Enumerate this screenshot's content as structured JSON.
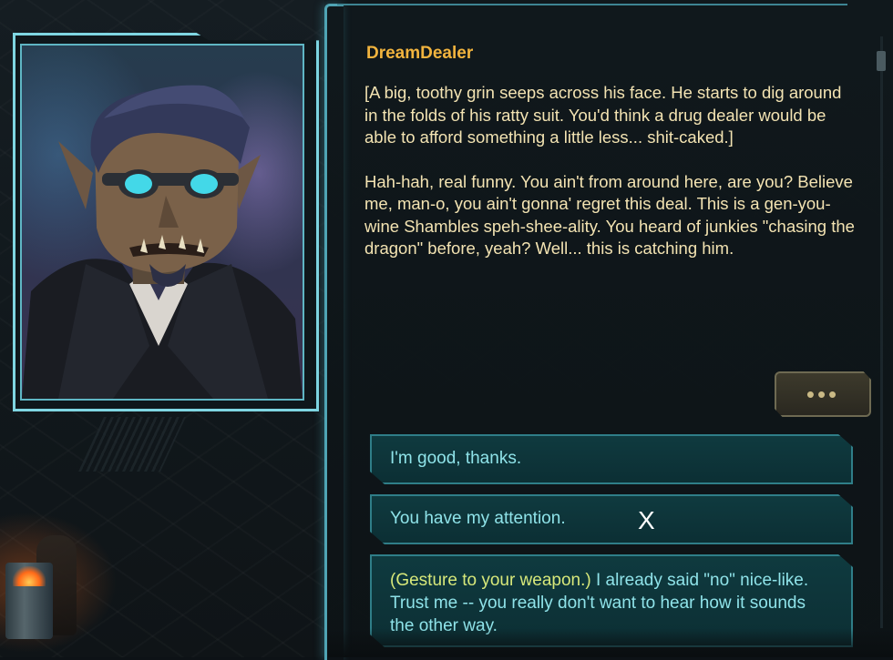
{
  "speaker_name": "DreamDealer",
  "dialog": {
    "narration": "[A big, toothy grin seeps across his face. He starts to dig around in the folds of his ratty suit. You'd think a drug dealer would be able to afford something a little less... shit-caked.]",
    "speech": "Hah-hah, real funny. You ain't from around here, are you? Believe me, man-o, you ain't gonna' regret this deal. This is a gen-you-wine Shambles speh-shee-ality. You heard of junkies \"chasing the dragon\" before, yeah? Well... this is catching him."
  },
  "continue_button": {
    "label": "•••"
  },
  "replies": [
    {
      "text": "I'm good, thanks."
    },
    {
      "text": "You have my attention."
    },
    {
      "action": "(Gesture to your weapon.)",
      "text": " I already said \"no\" nice-like. Trust me -- you really don't want to hear how it sounds the other way."
    }
  ],
  "cursor": {
    "glyph": "X"
  },
  "colors": {
    "speaker": "#f2b43e",
    "dialog_text": "#f3e3b2",
    "reply_text": "#8fe3e9",
    "reply_action": "#d7e87a",
    "frame_accent": "#7fd6e2"
  },
  "icons": {
    "portrait": "orc-portrait-with-goggles",
    "continue": "ellipsis-icon"
  }
}
